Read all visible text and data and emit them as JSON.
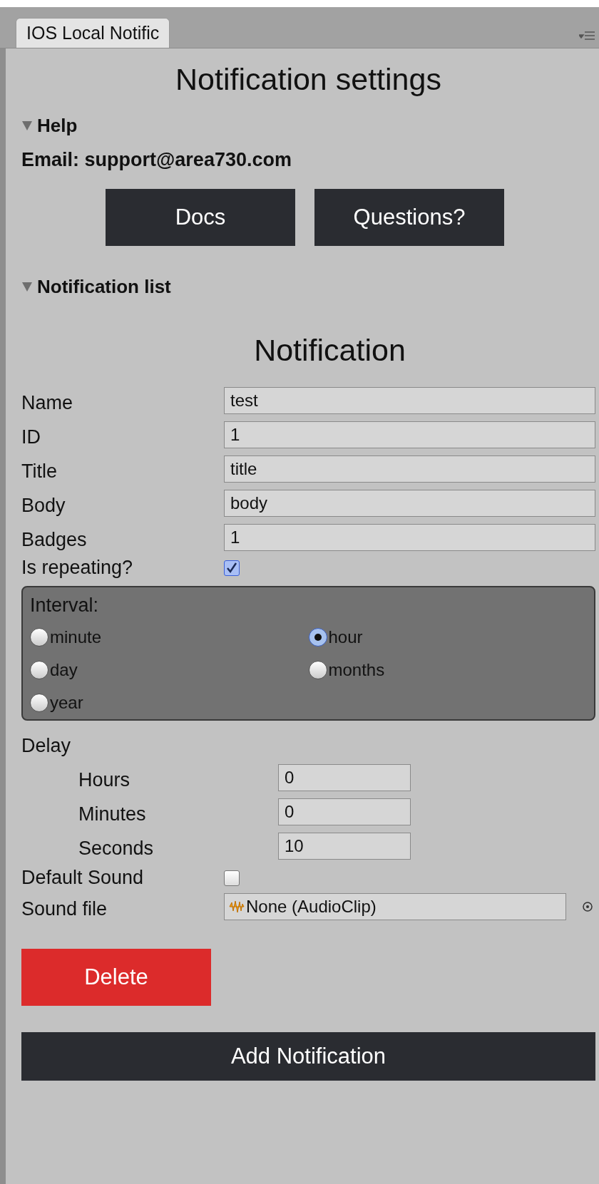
{
  "tab": {
    "label": "IOS Local Notific",
    "selected": true
  },
  "title": "Notification settings",
  "help": {
    "label": "Help",
    "expanded": true,
    "email": "Email: support@area730.com",
    "buttons": [
      "Docs",
      "Questions?"
    ]
  },
  "list": {
    "label": "Notification list",
    "expanded": true
  },
  "notification": {
    "heading": "Notification",
    "fields": [
      {
        "label": "Name",
        "value": "test"
      },
      {
        "label": "ID",
        "value": "1"
      },
      {
        "label": "Title",
        "value": "title"
      },
      {
        "label": "Body",
        "value": "body"
      },
      {
        "label": "Badges",
        "value": "1"
      }
    ],
    "repeating": {
      "label": "Is repeating?",
      "checked": true
    },
    "interval": {
      "label": "Interval:",
      "options": [
        {
          "label": "minute",
          "selected": false
        },
        {
          "label": "hour",
          "selected": true
        },
        {
          "label": "day",
          "selected": false
        },
        {
          "label": "months",
          "selected": false
        },
        {
          "label": "year",
          "selected": false
        }
      ]
    },
    "delay": {
      "label": "Delay",
      "fields": [
        {
          "label": "Hours",
          "value": "0"
        },
        {
          "label": "Minutes",
          "value": "0"
        },
        {
          "label": "Seconds",
          "value": "10"
        }
      ]
    },
    "default_sound": {
      "label": "Default Sound",
      "checked": false
    },
    "sound_file": {
      "label": "Sound file",
      "value": "None (AudioClip)"
    },
    "delete_button": "Delete"
  },
  "add_button": "Add Notification"
}
